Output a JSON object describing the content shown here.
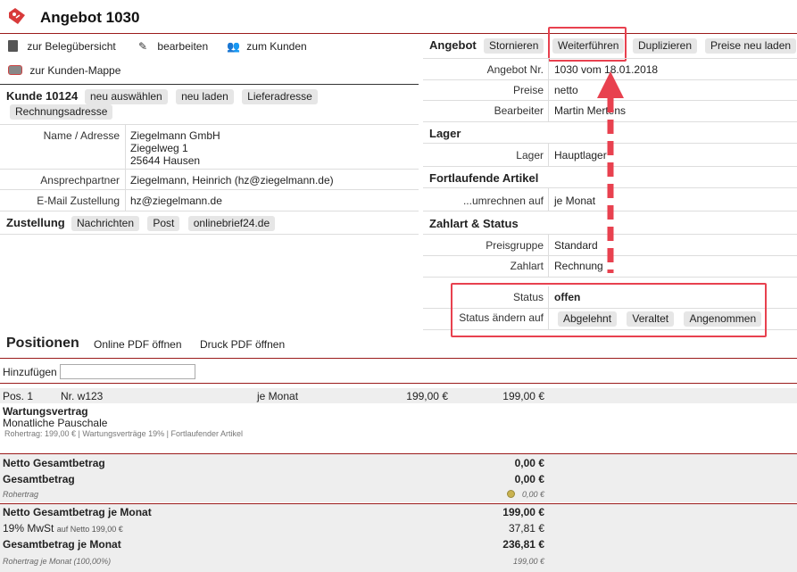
{
  "header": {
    "title": "Angebot 1030"
  },
  "toolbar": {
    "overview": "zur Belegübersicht",
    "edit": "bearbeiten",
    "customer": "zum Kunden",
    "customer_folder": "zur Kunden-Mappe"
  },
  "customer": {
    "title": "Kunde 10124",
    "buttons": [
      "neu auswählen",
      "neu laden",
      "Lieferadresse",
      "Rechnungsadresse"
    ],
    "name_label": "Name / Adresse",
    "name_lines": [
      "Ziegelmann GmbH",
      "Ziegelweg 1",
      "25644 Hausen"
    ],
    "contact_label": "Ansprechpartner",
    "contact_value": "Ziegelmann, Heinrich (hz@ziegelmann.de)",
    "email_label": "E-Mail Zustellung",
    "email_value": "hz@ziegelmann.de"
  },
  "delivery": {
    "title": "Zustellung",
    "buttons": [
      "Nachrichten",
      "Post",
      "onlinebrief24.de"
    ]
  },
  "offer": {
    "title": "Angebot",
    "buttons": [
      "Stornieren",
      "Weiterführen",
      "Duplizieren",
      "Preise neu laden"
    ],
    "number_label": "Angebot Nr.",
    "number_value": "1030 vom 18.01.2018",
    "price_label": "Preise",
    "price_value": "netto",
    "editor_label": "Bearbeiter",
    "editor_value": "Martin Mertens"
  },
  "stock": {
    "title": "Lager",
    "label": "Lager",
    "value": "Hauptlager"
  },
  "recurring": {
    "title": "Fortlaufende Artikel",
    "label": "...umrechnen auf",
    "value": "je Monat"
  },
  "payment": {
    "title": "Zahlart & Status",
    "group_label": "Preisgruppe",
    "group_value": "Standard",
    "method_label": "Zahlart",
    "method_value": "Rechnung",
    "status_label": "Status",
    "status_value": "offen",
    "change_label": "Status ändern auf",
    "change_buttons": [
      "Abgelehnt",
      "Veraltet",
      "Angenommen"
    ]
  },
  "positions": {
    "title": "Positionen",
    "online_pdf": "Online PDF öffnen",
    "print_pdf": "Druck PDF öffnen",
    "add_label": "Hinzufügen",
    "add_value": "",
    "item": {
      "pos": "Pos. 1",
      "nr": "Nr. w123",
      "interval": "je Monat",
      "price": "199,00 €",
      "total": "199,00 €",
      "name": "Wartungsvertrag",
      "desc": "Monatliche Pauschale",
      "meta": "Rohertrag: 199,00 € | Wartungsverträge 19% | Fortlaufender Artikel"
    }
  },
  "totals": {
    "net_label": "Netto Gesamtbetrag",
    "net_value": "0,00 €",
    "gross_label": "Gesamtbetrag",
    "gross_value": "0,00 €",
    "margin_label": "Rohertrag",
    "margin_value": "0,00 €",
    "net_month_label": "Netto Gesamtbetrag je Monat",
    "net_month_value": "199,00 €",
    "vat_label": "19% MwSt",
    "vat_note": "auf Netto 199,00 €",
    "vat_value": "37,81 €",
    "gross_month_label": "Gesamtbetrag je Monat",
    "gross_month_value": "236,81 €",
    "margin_month_label": "Rohertrag je Monat (100,00%)",
    "margin_month_value": "199,00 €"
  },
  "colors": {
    "accent_red": "#9b1b1b",
    "highlight": "#e8414f"
  }
}
